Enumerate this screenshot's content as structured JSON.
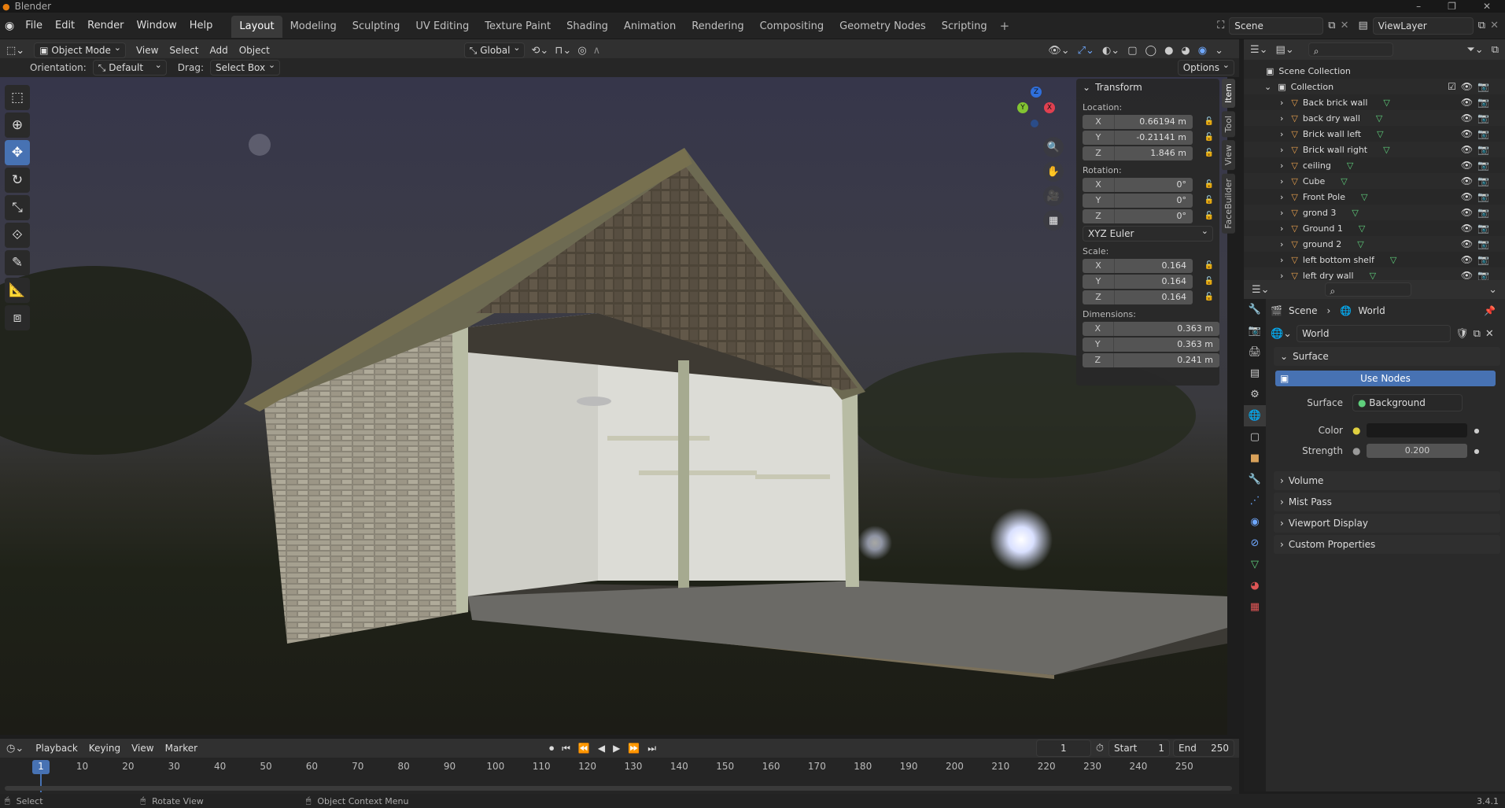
{
  "app": {
    "title": "Blender",
    "version": "3.4.1"
  },
  "menu": [
    "File",
    "Edit",
    "Render",
    "Window",
    "Help"
  ],
  "workspaces": [
    "Layout",
    "Modeling",
    "Sculpting",
    "UV Editing",
    "Texture Paint",
    "Shading",
    "Animation",
    "Rendering",
    "Compositing",
    "Geometry Nodes",
    "Scripting"
  ],
  "scene": {
    "name": "Scene",
    "view_layer": "ViewLayer"
  },
  "header": {
    "mode": "Object Mode",
    "view": "View",
    "select": "Select",
    "add": "Add",
    "object": "Object",
    "transform_orientation": "Global"
  },
  "tool_settings": {
    "orientation_label": "Orientation:",
    "orientation": "Default",
    "drag_label": "Drag:",
    "drag": "Select Box",
    "options": "Options"
  },
  "npanel": {
    "title": "Transform",
    "location_label": "Location:",
    "location": {
      "x": "0.66194 m",
      "y": "-0.21141 m",
      "z": "1.846 m"
    },
    "rotation_label": "Rotation:",
    "rotation": {
      "x": "0°",
      "y": "0°",
      "z": "0°"
    },
    "rotation_mode": "XYZ Euler",
    "scale_label": "Scale:",
    "scale": {
      "x": "0.164",
      "y": "0.164",
      "z": "0.164"
    },
    "dimensions_label": "Dimensions:",
    "dimensions": {
      "x": "0.363 m",
      "y": "0.363 m",
      "z": "0.241 m"
    },
    "axis": {
      "x": "X",
      "y": "Y",
      "z": "Z"
    },
    "tabs": [
      "Item",
      "Tool",
      "View",
      "FaceBuilder"
    ]
  },
  "gizmo": {
    "x": "X",
    "y": "Y",
    "z": "Z"
  },
  "outliner": {
    "root": "Scene Collection",
    "collection": "Collection",
    "items": [
      "Back brick wall",
      "back dry wall",
      "Brick wall left",
      "Brick wall right",
      "ceiling",
      "Cube",
      "Front Pole",
      "grond 3",
      "Ground 1",
      "ground 2",
      "left bottom shelf",
      "left dry wall"
    ]
  },
  "properties": {
    "breadcrumb_scene": "Scene",
    "breadcrumb_world": "World",
    "world_name": "World",
    "surface_panel": "Surface",
    "use_nodes": "Use Nodes",
    "surface_label": "Surface",
    "surface_value": "Background",
    "color_label": "Color",
    "strength_label": "Strength",
    "strength_value": "0.200",
    "panels": [
      "Volume",
      "Mist Pass",
      "Viewport Display",
      "Custom Properties"
    ]
  },
  "timeline": {
    "playback": "Playback",
    "keying": "Keying",
    "view": "View",
    "marker": "Marker",
    "current_frame": "1",
    "start_label": "Start",
    "start": "1",
    "end_label": "End",
    "end": "250",
    "ticks": [
      "1",
      "10",
      "20",
      "30",
      "40",
      "50",
      "60",
      "70",
      "80",
      "90",
      "100",
      "110",
      "120",
      "130",
      "140",
      "150",
      "160",
      "170",
      "180",
      "190",
      "200",
      "210",
      "220",
      "230",
      "240",
      "250"
    ]
  },
  "status": {
    "select": "Select",
    "rotate": "Rotate View",
    "context": "Object Context Menu"
  },
  "colors": {
    "accent": "#4772b3",
    "active_frame": "#4772b3"
  }
}
